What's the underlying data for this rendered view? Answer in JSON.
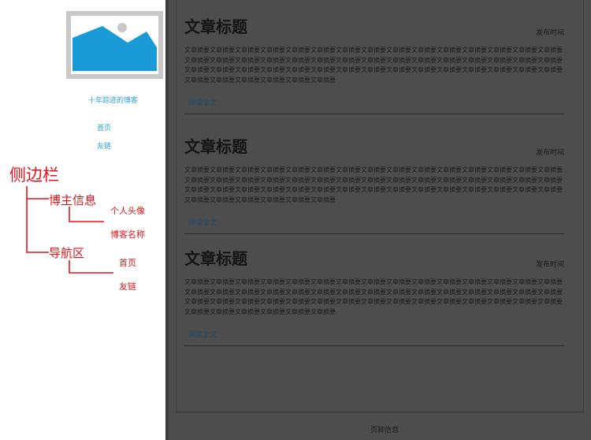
{
  "sidebar": {
    "avatar_icon": "image-placeholder-icon",
    "blog_name": "十年踪迹的博客",
    "nav": [
      {
        "label": "首页"
      },
      {
        "label": "友链"
      }
    ]
  },
  "annotations": {
    "sidebar": "侧边栏",
    "blogger_info": "博主信息",
    "avatar": "个人头像",
    "blog_name": "博客名称",
    "nav_area": "导航区",
    "home": "首页",
    "friend_links": "友链"
  },
  "articles": [
    {
      "title": "文章标题",
      "date": "发布时间",
      "summary": "文章摘要文章摘要文章摘要文章摘要文章摘要文章摘要文章摘要文章摘要文章摘要文章摘要文章摘要文章摘要文章摘要文章摘要文章摘要文章摘要文章摘要文章摘要文章摘要文章摘要文章摘要文章摘要文章摘要文章摘要文章摘要文章摘要文章摘要文章摘要文章摘要文章摘要文章摘要文章摘要文章摘要文章摘要文章摘要文章摘要文章摘要文章摘要文章摘要文章摘要文章摘要文章摘要文章摘要文章摘要文章摘要文章摘要文章摘要文章摘要文章摘要文章摘要文章摘要",
      "read_more": "阅读全文"
    },
    {
      "title": "文章标题",
      "date": "发布时间",
      "summary": "文章摘要文章摘要文章摘要文章摘要文章摘要文章摘要文章摘要文章摘要文章摘要文章摘要文章摘要文章摘要文章摘要文章摘要文章摘要文章摘要文章摘要文章摘要文章摘要文章摘要文章摘要文章摘要文章摘要文章摘要文章摘要文章摘要文章摘要文章摘要文章摘要文章摘要文章摘要文章摘要文章摘要文章摘要文章摘要文章摘要文章摘要文章摘要文章摘要文章摘要文章摘要文章摘要文章摘要文章摘要文章摘要文章摘要文章摘要文章摘要文章摘要文章摘要文章摘要",
      "read_more": "阅读全文"
    },
    {
      "title": "文章标题",
      "date": "发布时间",
      "summary": "文章摘要文章摘要文章摘要文章摘要文章摘要文章摘要文章摘要文章摘要文章摘要文章摘要文章摘要文章摘要文章摘要文章摘要文章摘要文章摘要文章摘要文章摘要文章摘要文章摘要文章摘要文章摘要文章摘要文章摘要文章摘要文章摘要文章摘要文章摘要文章摘要文章摘要文章摘要文章摘要文章摘要文章摘要文章摘要文章摘要文章摘要文章摘要文章摘要文章摘要文章摘要文章摘要文章摘要文章摘要文章摘要文章摘要文章摘要文章摘要文章摘要文章摘要文章摘要",
      "read_more": "阅读全文"
    }
  ],
  "footer": {
    "text": "页脚信息"
  },
  "colors": {
    "link": "#2a9fd8",
    "annotation": "#e0161c",
    "overlay": "#4d4d4d",
    "image_sky": "#1a9ad6"
  }
}
